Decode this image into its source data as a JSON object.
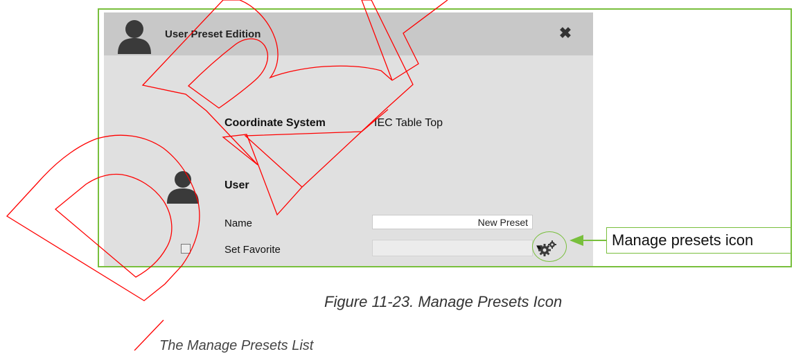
{
  "dialog": {
    "title": "User Preset Edition",
    "close_symbol": "✖",
    "coordinate_system": {
      "label": "Coordinate System",
      "value": "IEC Table Top"
    },
    "user_section": {
      "heading": "User",
      "name_label": "Name",
      "name_value": "New Preset",
      "favorite_label": "Set Favorite",
      "favorite_checked": false,
      "favorite_selected": "",
      "dropdown_symbol": "▼"
    },
    "icons": [
      "user-avatar-icon",
      "close-icon",
      "gear-icon",
      "chevron-down-icon"
    ]
  },
  "callout": {
    "text": "Manage presets icon"
  },
  "caption": "Figure 11-23. Manage Presets Icon",
  "partial_text": "The Manage Presets List",
  "colors": {
    "accent_green": "#78bf3c",
    "stamp_red": "#ff0000",
    "header_bg": "#c8c8c8",
    "dialog_bg": "#e0e0e0"
  }
}
